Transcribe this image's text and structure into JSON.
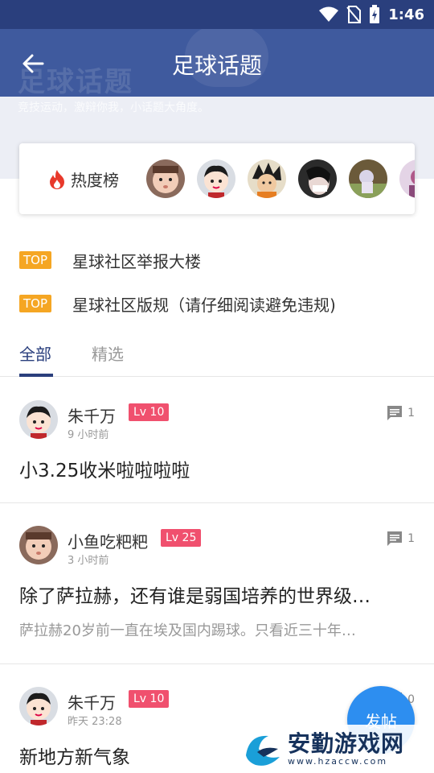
{
  "status": {
    "time": "1:46"
  },
  "banner": {
    "ghost_title": "足球话题",
    "ghost_subtitle": "竞技运动，激辩你我，小话题大角度。",
    "title": "足球话题"
  },
  "hot": {
    "label": "热度榜",
    "avatar_count": 6
  },
  "pinned": [
    {
      "tag": "TOP",
      "text": "星球社区举报大楼"
    },
    {
      "tag": "TOP",
      "text": "星球社区版规（请仔细阅读避免违规)"
    }
  ],
  "tabs": [
    {
      "label": "全部"
    },
    {
      "label": "精选"
    }
  ],
  "posts": [
    {
      "author": "朱千万",
      "level": "Lv 10",
      "time": "9 小时前",
      "comments": "1",
      "title": "小3.25收米啦啦啦啦",
      "excerpt": ""
    },
    {
      "author": "小鱼吃粑粑",
      "level": "Lv 25",
      "time": "3 小时前",
      "comments": "1",
      "title": "除了萨拉赫，还有谁是弱国培养的世界级…",
      "excerpt": "萨拉赫20岁前一直在埃及国内踢球。只看近三十年…"
    },
    {
      "author": "朱千万",
      "level": "Lv 10",
      "time": "昨天 23:28",
      "comments": "0",
      "title": "新地方新气象",
      "excerpt": ""
    }
  ],
  "fab": {
    "label": "发帖"
  },
  "watermark": {
    "main": "安勤游戏网",
    "sub": "www.hzaccw.com"
  },
  "colors": {
    "primary": "#2a3f7d",
    "banner": "#3f5a9e",
    "top_tag": "#f5a623",
    "level_badge": "#f0506e",
    "fab": "#2d8ef0"
  }
}
